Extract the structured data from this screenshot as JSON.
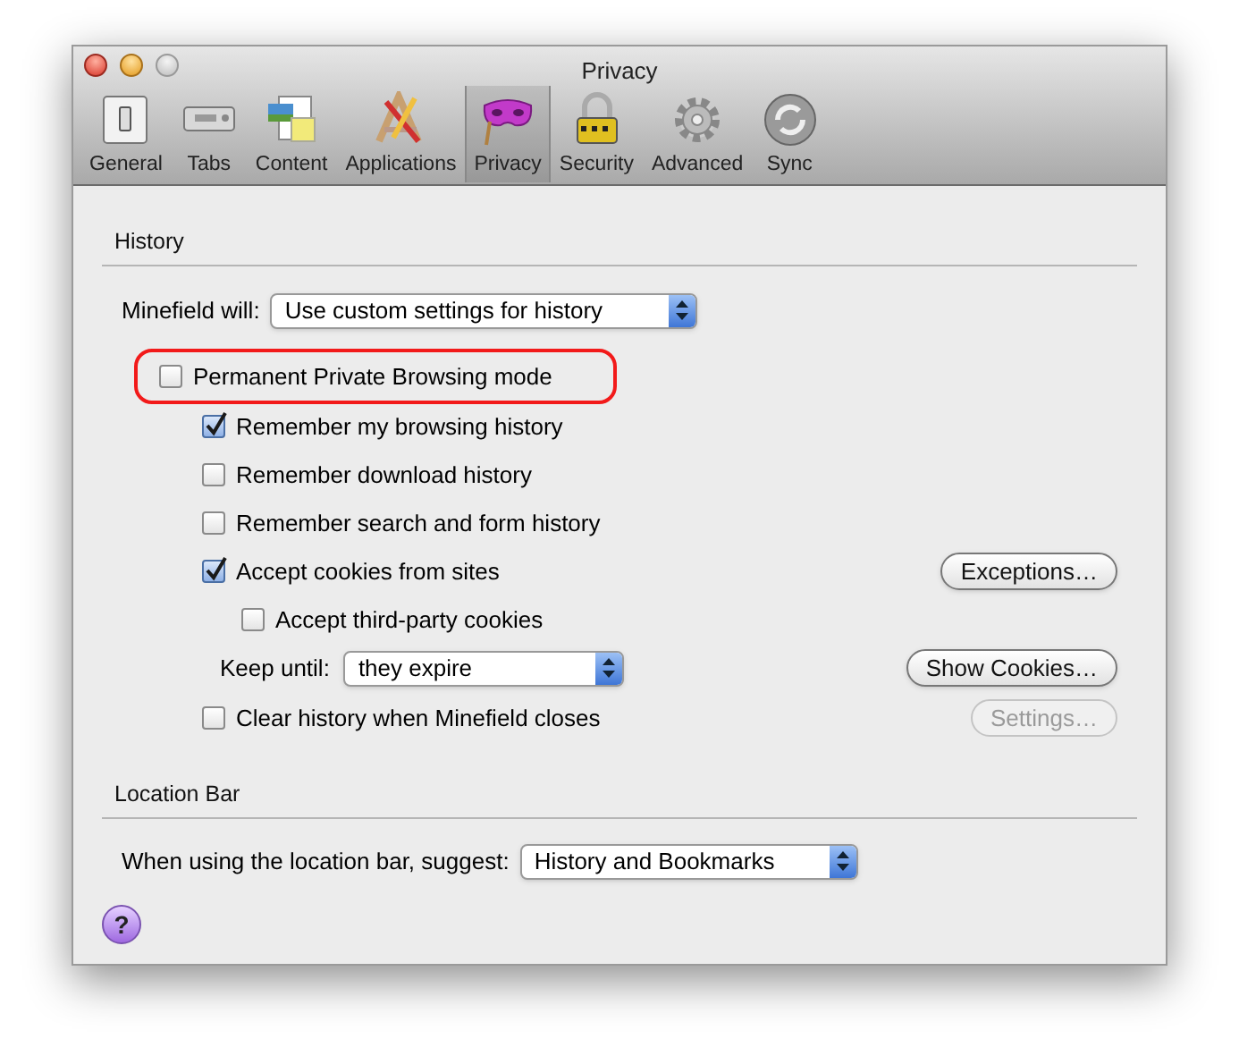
{
  "window": {
    "title": "Privacy"
  },
  "toolbar": [
    {
      "label": "General",
      "selected": false
    },
    {
      "label": "Tabs",
      "selected": false
    },
    {
      "label": "Content",
      "selected": false
    },
    {
      "label": "Applications",
      "selected": false
    },
    {
      "label": "Privacy",
      "selected": true
    },
    {
      "label": "Security",
      "selected": false
    },
    {
      "label": "Advanced",
      "selected": false
    },
    {
      "label": "Sync",
      "selected": false
    }
  ],
  "history": {
    "heading": "History",
    "mode_label": "Minefield will:",
    "mode_select": "Use custom settings for history",
    "private_browsing": {
      "label": "Permanent Private Browsing mode",
      "checked": false,
      "highlighted": true
    },
    "options": [
      {
        "kind": "checkbox",
        "label": "Remember my browsing history",
        "checked": true
      },
      {
        "kind": "checkbox",
        "label": "Remember download history",
        "checked": false
      },
      {
        "kind": "checkbox",
        "label": "Remember search and form history",
        "checked": false
      },
      {
        "kind": "checkbox",
        "label": "Accept cookies from sites",
        "checked": true,
        "button": {
          "label": "Exceptions…",
          "disabled": false
        },
        "children": [
          {
            "kind": "checkbox",
            "label": "Accept third-party cookies",
            "checked": false
          },
          {
            "kind": "select",
            "label": "Keep until:",
            "value": "they expire",
            "button": {
              "label": "Show Cookies…",
              "disabled": false
            }
          }
        ]
      },
      {
        "kind": "checkbox",
        "label": "Clear history when Minefield closes",
        "checked": false,
        "button": {
          "label": "Settings…",
          "disabled": true
        }
      }
    ]
  },
  "location_bar": {
    "heading": "Location Bar",
    "suggest_label": "When using the location bar, suggest:",
    "suggest_select": "History and Bookmarks"
  },
  "help_button": "?"
}
